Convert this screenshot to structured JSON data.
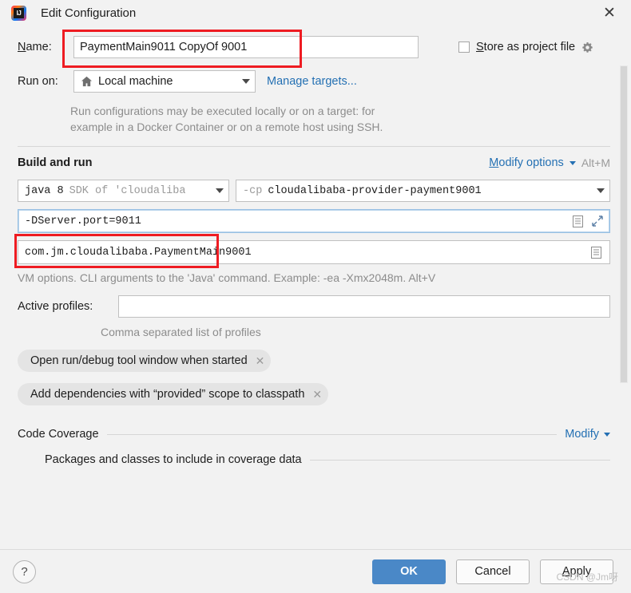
{
  "window": {
    "title": "Edit Configuration",
    "app_icon": "intellij-idea-icon",
    "close_icon": "close-icon"
  },
  "name_row": {
    "label": "Name:",
    "label_mnemonic": "N",
    "value": "PaymentMain9011 CopyOf 9001",
    "store_as_project_file": {
      "label": "Store as project file",
      "mnemonic": "S",
      "checked": false,
      "gear_icon": "gear-icon"
    }
  },
  "run_on": {
    "label": "Run on:",
    "value": "Local machine",
    "icon": "home-icon",
    "manage_targets_link": "Manage targets...",
    "description_line1": "Run configurations may be executed locally or on a target: for",
    "description_line2": "example in a Docker Container or on a remote host using SSH."
  },
  "build_and_run": {
    "title": "Build and run",
    "modify_options_link": "Modify options",
    "modify_options_mnemonic": "M",
    "modify_options_shortcut": "Alt+M",
    "sdk": {
      "primary": "java 8",
      "secondary": "SDK of 'cloudaliba"
    },
    "classpath": {
      "prefix": "-cp",
      "value": "cloudalibaba-provider-payment9001"
    },
    "vm_options": {
      "value": "-DServer.port=9011",
      "doc_icon": "document-icon",
      "expand_icon": "expand-icon"
    },
    "main_class": {
      "value": "com.jm.cloudalibaba.PaymentMain9001",
      "doc_icon": "document-icon"
    },
    "vm_hint": "VM options. CLI arguments to the 'Java' command. Example: -ea -Xmx2048m. Alt+V"
  },
  "active_profiles": {
    "label": "Active profiles:",
    "value": "",
    "hint": "Comma separated list of profiles"
  },
  "option_chips": [
    {
      "label": "Open run/debug tool window when started",
      "remove_icon": "close-icon"
    },
    {
      "label": "Add dependencies with “provided” scope to classpath",
      "remove_icon": "close-icon"
    }
  ],
  "code_coverage": {
    "title": "Code Coverage",
    "modify_link": "Modify",
    "subtitle": "Packages and classes to include in coverage data"
  },
  "footer": {
    "help_icon": "?",
    "ok": "OK",
    "cancel": "Cancel",
    "apply": "Apply",
    "apply_mnemonic": "A"
  },
  "watermark": "CSDN @Jm呀",
  "colors": {
    "accent_blue": "#2470b3",
    "primary_button": "#4a88c7",
    "annotation_red": "#ee1c22",
    "dialog_bg": "#f2f2f2"
  },
  "scrollbar": {
    "visible": true
  }
}
